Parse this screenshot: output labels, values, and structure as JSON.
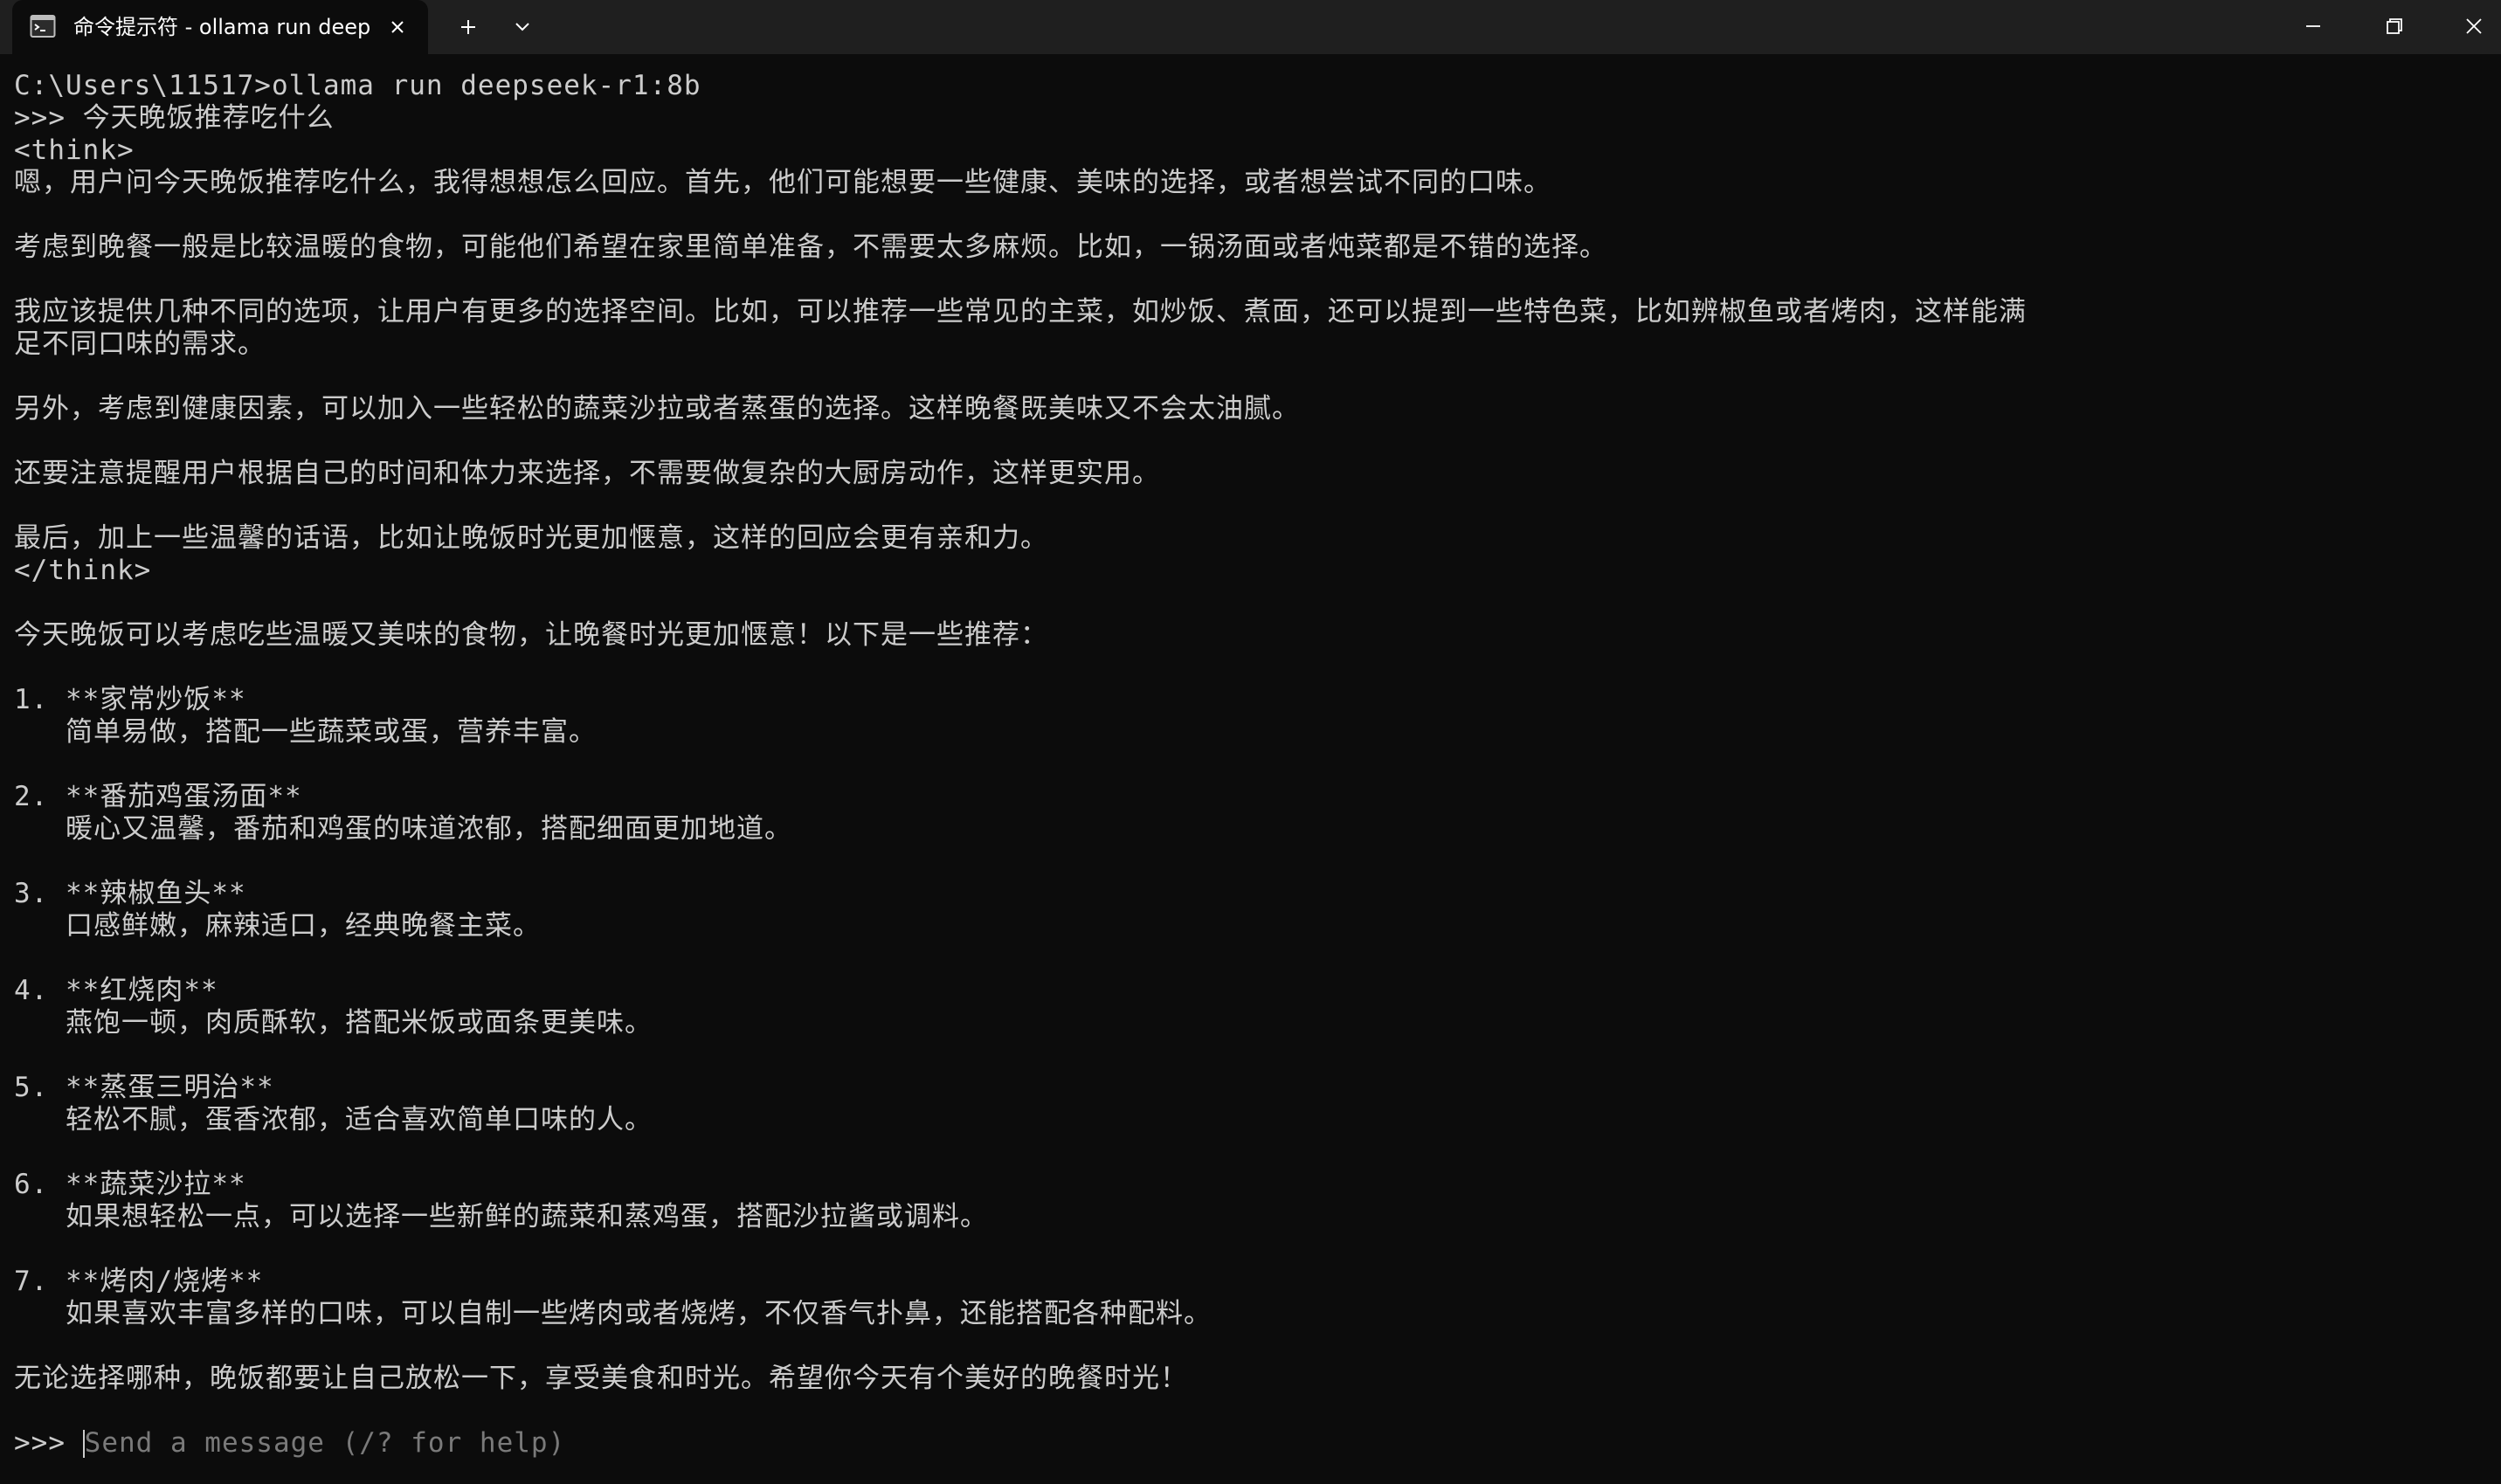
{
  "tab": {
    "title": "命令提示符 - ollama  run deep",
    "icon": "terminal-icon"
  },
  "titlebar_icons": {
    "close_tab": "close-icon",
    "new_tab": "plus-icon",
    "dropdown": "chevron-down-icon",
    "minimize": "minimize-icon",
    "maximize": "restore-icon",
    "close_window": "close-icon"
  },
  "colors": {
    "background": "#0c0c0c",
    "titlebar": "#1f1f1f",
    "text": "#cccccc",
    "placeholder": "#7a7a7a"
  },
  "terminal": {
    "lines": [
      "C:\\Users\\11517>ollama run deepseek-r1:8b",
      ">>> 今天晚饭推荐吃什么",
      "<think>",
      "嗯，用户问今天晚饭推荐吃什么，我得想想怎么回应。首先，他们可能想要一些健康、美味的选择，或者想尝试不同的口味。",
      "",
      "考虑到晚餐一般是比较温暖的食物，可能他们希望在家里简单准备，不需要太多麻烦。比如，一锅汤面或者炖菜都是不错的选择。",
      "",
      "我应该提供几种不同的选项，让用户有更多的选择空间。比如，可以推荐一些常见的主菜，如炒饭、煮面，还可以提到一些特色菜，比如辨椒鱼或者烤肉，这样能满",
      "足不同口味的需求。",
      "",
      "另外，考虑到健康因素，可以加入一些轻松的蔬菜沙拉或者蒸蛋的选择。这样晚餐既美味又不会太油腻。",
      "",
      "还要注意提醒用户根据自己的时间和体力来选择，不需要做复杂的大厨房动作，这样更实用。",
      "",
      "最后，加上一些温馨的话语，比如让晚饭时光更加惬意，这样的回应会更有亲和力。",
      "</think>",
      "",
      "今天晚饭可以考虑吃些温暖又美味的食物，让晚餐时光更加惬意！以下是一些推荐：",
      "",
      "1. **家常炒饭**",
      "   简单易做，搭配一些蔬菜或蛋，营养丰富。",
      "",
      "2. **番茄鸡蛋汤面**",
      "   暖心又温馨，番茄和鸡蛋的味道浓郁，搭配细面更加地道。",
      "",
      "3. **辣椒鱼头**",
      "   口感鲜嫩，麻辣适口，经典晚餐主菜。",
      "",
      "4. **红烧肉**",
      "   燕饱一顿，肉质酥软，搭配米饭或面条更美味。",
      "",
      "5. **蒸蛋三明治**",
      "   轻松不腻，蛋香浓郁，适合喜欢简单口味的人。",
      "",
      "6. **蔬菜沙拉**",
      "   如果想轻松一点，可以选择一些新鲜的蔬菜和蒸鸡蛋，搭配沙拉酱或调料。",
      "",
      "7. **烤肉/烧烤**",
      "   如果喜欢丰富多样的口味，可以自制一些烤肉或者烧烤，不仅香气扑鼻，还能搭配各种配料。",
      "",
      "无论选择哪种，晚饭都要让自己放松一下，享受美食和时光。希望你今天有个美好的晚餐时光！",
      ""
    ],
    "prompt": {
      "prefix": ">>> ",
      "placeholder": "Send a message (/? for help)"
    }
  }
}
